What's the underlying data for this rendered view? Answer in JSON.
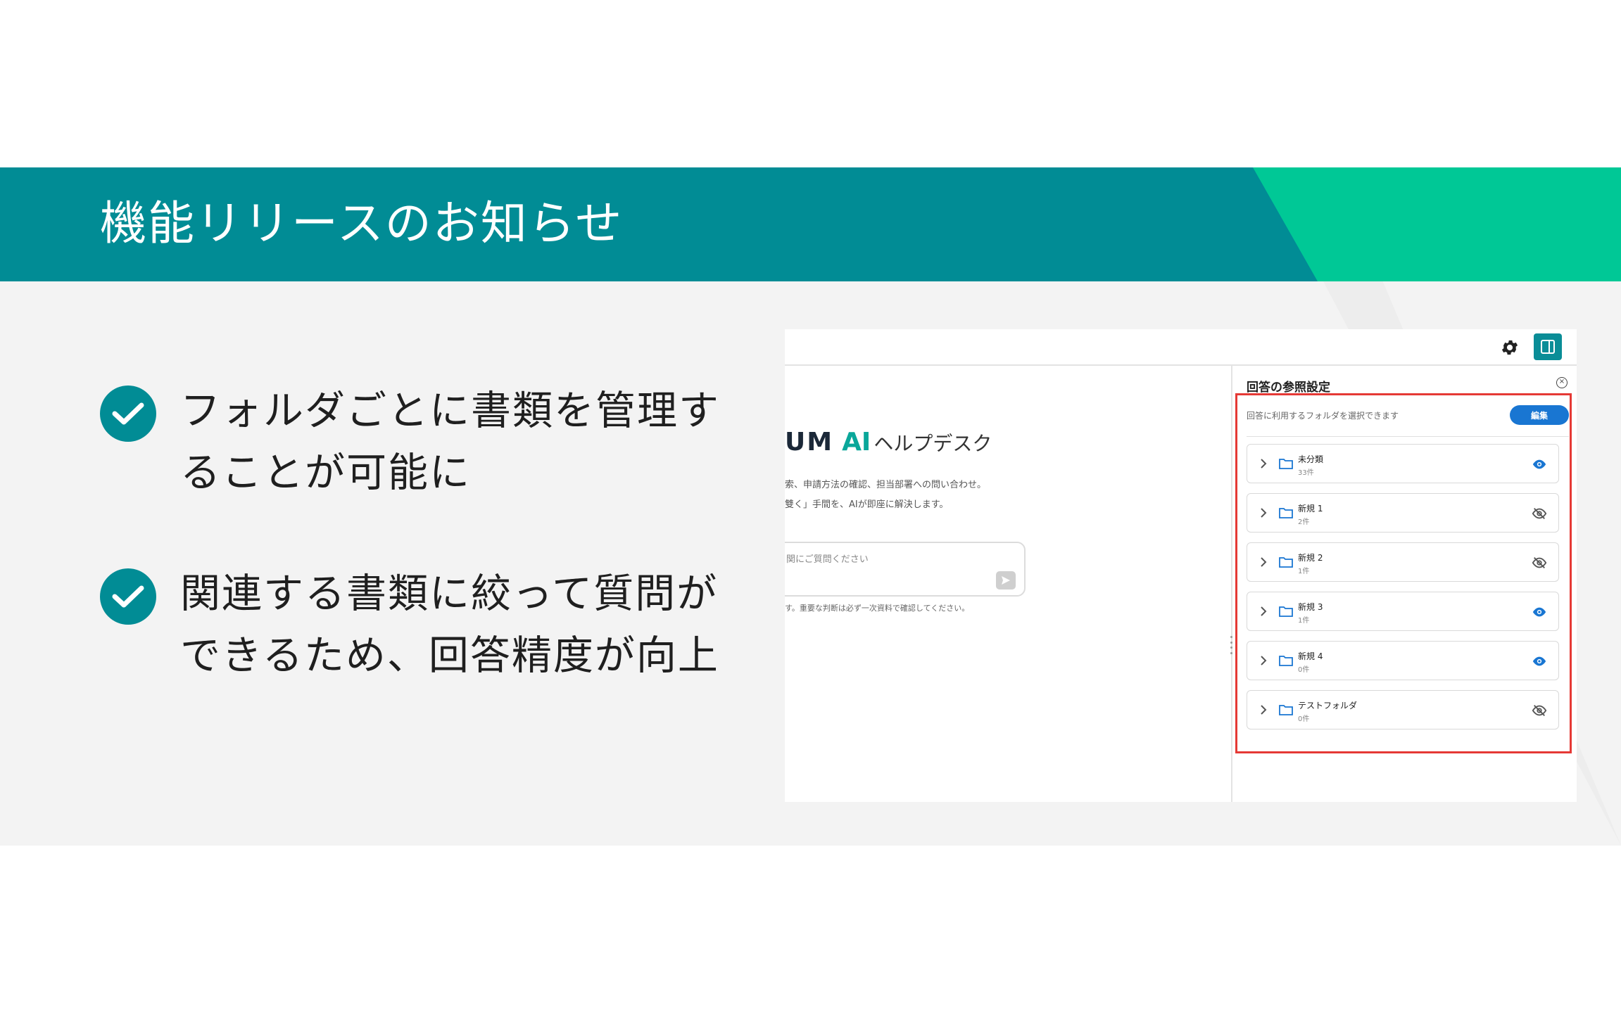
{
  "slide": {
    "title": "機能リリースのお知らせ",
    "features": [
      "フォルダごとに書類を管理することが可能に",
      "関連する書類に絞って質問ができるため、回答精度が向上"
    ]
  },
  "colors": {
    "banner": "#018c95",
    "banner_accent": "#00c896",
    "check": "#018c95",
    "highlight": "#e53935",
    "edit_button": "#1976d2",
    "eye_visible": "#1976d2",
    "eye_hidden": "#555555"
  },
  "screenshot": {
    "brand": {
      "prefix": "UM",
      "ai": "AI",
      "suffix": "ヘルプデスク"
    },
    "description_lines": [
      "索、申請方法の確認、担当部署への問い合わせ。",
      "雙く」手間を、AIが即座に解決します。"
    ],
    "chat": {
      "placeholder": "関にご質問ください",
      "disclaimer": "す。重要な判断は必ず一次資料で確認してください。"
    },
    "reference_panel": {
      "title": "回答の参照設定",
      "description": "回答に利用するフォルダを選択できます",
      "edit_label": "編集",
      "folders": [
        {
          "name": "未分類",
          "count": "33件",
          "visible": true
        },
        {
          "name": "新規 1",
          "count": "2件",
          "visible": false
        },
        {
          "name": "新規 2",
          "count": "1件",
          "visible": false
        },
        {
          "name": "新規 3",
          "count": "1件",
          "visible": true
        },
        {
          "name": "新規 4",
          "count": "0件",
          "visible": true
        },
        {
          "name": "テストフォルダ",
          "count": "0件",
          "visible": false
        }
      ]
    },
    "icons": [
      "gear-icon",
      "panel-toggle-icon",
      "close-icon",
      "send-icon",
      "chevron-right-icon",
      "folder-icon",
      "eye-icon",
      "eye-off-icon"
    ]
  }
}
